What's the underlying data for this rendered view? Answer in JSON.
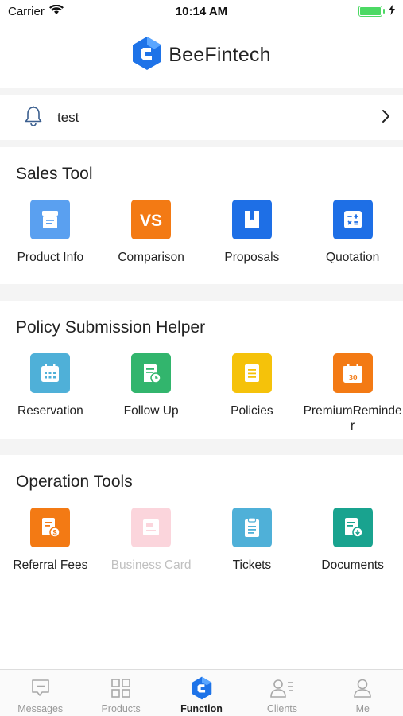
{
  "status_bar": {
    "carrier": "Carrier",
    "time": "10:14 AM",
    "battery_level": 1.0
  },
  "header": {
    "brand": "BeeFintech",
    "brand_color": "#1e73e8"
  },
  "notice": {
    "text": "test"
  },
  "sections": [
    {
      "title": "Sales Tool",
      "items": [
        {
          "label": "Product Info",
          "icon": "product-info-icon",
          "color": "#5aa0f0"
        },
        {
          "label": "Comparison",
          "icon": "vs-icon",
          "color": "#f37a14"
        },
        {
          "label": "Proposals",
          "icon": "book-icon",
          "color": "#1e6fe6"
        },
        {
          "label": "Quotation",
          "icon": "calculator-icon",
          "color": "#1e6fe6"
        }
      ]
    },
    {
      "title": "Policy Submission Helper",
      "items": [
        {
          "label": "Reservation",
          "icon": "calendar-icon",
          "color": "#4fb0d8"
        },
        {
          "label": "Follow Up",
          "icon": "document-clock-icon",
          "color": "#32b56d"
        },
        {
          "label": "Policies",
          "icon": "document-icon",
          "color": "#f5c20a"
        },
        {
          "label": "PremiumReminder",
          "icon": "calendar-30-icon",
          "color": "#f37a14"
        }
      ]
    },
    {
      "title": "Operation Tools",
      "items": [
        {
          "label": "Referral Fees",
          "icon": "document-dollar-icon",
          "color": "#f37a14"
        },
        {
          "label": "Business Card",
          "icon": "business-card-icon",
          "color": "#fbd5dc",
          "disabled": true
        },
        {
          "label": "Tickets",
          "icon": "clipboard-icon",
          "color": "#4fb0d8"
        },
        {
          "label": "Documents",
          "icon": "document-download-icon",
          "color": "#19a38f"
        }
      ]
    }
  ],
  "tabbar": [
    {
      "label": "Messages",
      "icon": "message-icon"
    },
    {
      "label": "Products",
      "icon": "grid-icon"
    },
    {
      "label": "Function",
      "icon": "brand-logo-icon",
      "active": true
    },
    {
      "label": "Clients",
      "icon": "clients-icon"
    },
    {
      "label": "Me",
      "icon": "person-icon"
    }
  ],
  "colors": {
    "accent": "#1e73e8",
    "tab_inactive": "#999999",
    "tab_active": "#222222"
  }
}
